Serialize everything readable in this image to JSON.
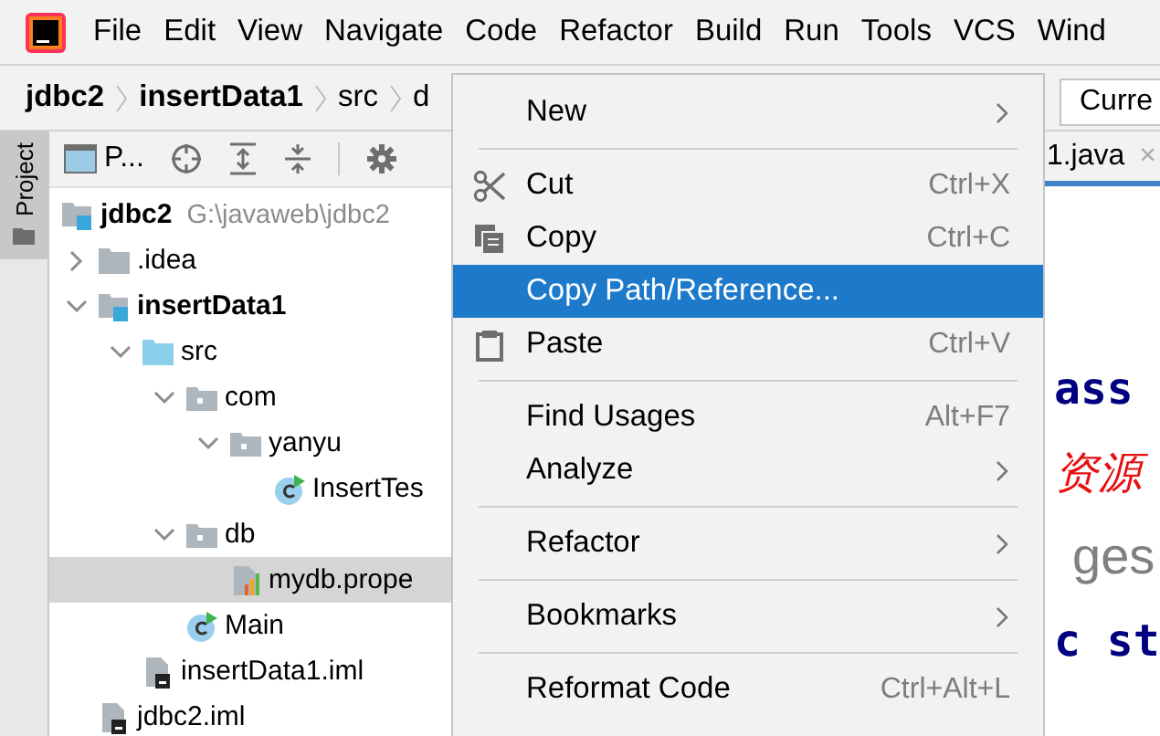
{
  "menu_bar": [
    "File",
    "Edit",
    "View",
    "Navigate",
    "Code",
    "Refactor",
    "Build",
    "Run",
    "Tools",
    "VCS",
    "Wind"
  ],
  "breadcrumb": [
    "jdbc2",
    "insertData1",
    "src",
    "d"
  ],
  "current_button": "Curre",
  "side_stripe": {
    "label": "Project"
  },
  "project_panel": {
    "title": "P...",
    "tree": [
      {
        "kind": "module",
        "label": "jdbc2",
        "bold": true,
        "path": "G:\\javaweb\\jdbc2",
        "selected": false,
        "children": [
          {
            "kind": "folder",
            "label": ".idea",
            "bold": false,
            "expanded": false,
            "selected": false
          },
          {
            "kind": "module",
            "label": "insertData1",
            "bold": true,
            "expanded": true,
            "selected": false,
            "children": [
              {
                "kind": "source",
                "label": "src",
                "bold": false,
                "expanded": true,
                "selected": false,
                "children": [
                  {
                    "kind": "package",
                    "label": "com",
                    "bold": false,
                    "expanded": true,
                    "selected": false,
                    "children": [
                      {
                        "kind": "package",
                        "label": "yanyu",
                        "bold": false,
                        "expanded": true,
                        "selected": false,
                        "children": [
                          {
                            "kind": "class",
                            "label": "InsertTes",
                            "bold": false,
                            "selected": false
                          }
                        ]
                      }
                    ]
                  },
                  {
                    "kind": "package",
                    "label": "db",
                    "bold": false,
                    "expanded": true,
                    "selected": false,
                    "children": [
                      {
                        "kind": "properties",
                        "label": "mydb.prope",
                        "bold": false,
                        "selected": true
                      }
                    ]
                  },
                  {
                    "kind": "class",
                    "label": "Main",
                    "bold": false,
                    "selected": false
                  }
                ]
              },
              {
                "kind": "iml",
                "label": "insertData1.iml",
                "bold": false,
                "selected": false
              }
            ]
          },
          {
            "kind": "iml",
            "label": "jdbc2.iml",
            "bold": false,
            "selected": false
          }
        ]
      }
    ]
  },
  "editor": {
    "tab": {
      "label": "1.java",
      "close": "×"
    },
    "lines": [
      {
        "kind": "keyword",
        "text": "ass"
      },
      {
        "kind": "comment",
        "text": "资源"
      },
      {
        "kind": "gray",
        "text": "ges"
      },
      {
        "kind": "keyword",
        "text": "c st"
      }
    ]
  },
  "context_menu": [
    {
      "kind": "item",
      "label": "New",
      "submenu": true,
      "selected": false
    },
    {
      "kind": "separator"
    },
    {
      "kind": "cut",
      "label": "Cut",
      "shortcut": "Ctrl+X",
      "selected": false
    },
    {
      "kind": "copy",
      "label": "Copy",
      "shortcut": "Ctrl+C",
      "selected": false
    },
    {
      "kind": "item",
      "label": "Copy Path/Reference...",
      "selected": true
    },
    {
      "kind": "paste",
      "label": "Paste",
      "shortcut": "Ctrl+V",
      "selected": false
    },
    {
      "kind": "separator"
    },
    {
      "kind": "item",
      "label": "Find Usages",
      "shortcut": "Alt+F7",
      "selected": false
    },
    {
      "kind": "item",
      "label": "Analyze",
      "submenu": true,
      "selected": false
    },
    {
      "kind": "separator"
    },
    {
      "kind": "item",
      "label": "Refactor",
      "submenu": true,
      "selected": false
    },
    {
      "kind": "separator"
    },
    {
      "kind": "item",
      "label": "Bookmarks",
      "submenu": true,
      "selected": false
    },
    {
      "kind": "separator"
    },
    {
      "kind": "item",
      "label": "Reformat Code",
      "shortcut": "Ctrl+Alt+L",
      "selected": false
    }
  ]
}
